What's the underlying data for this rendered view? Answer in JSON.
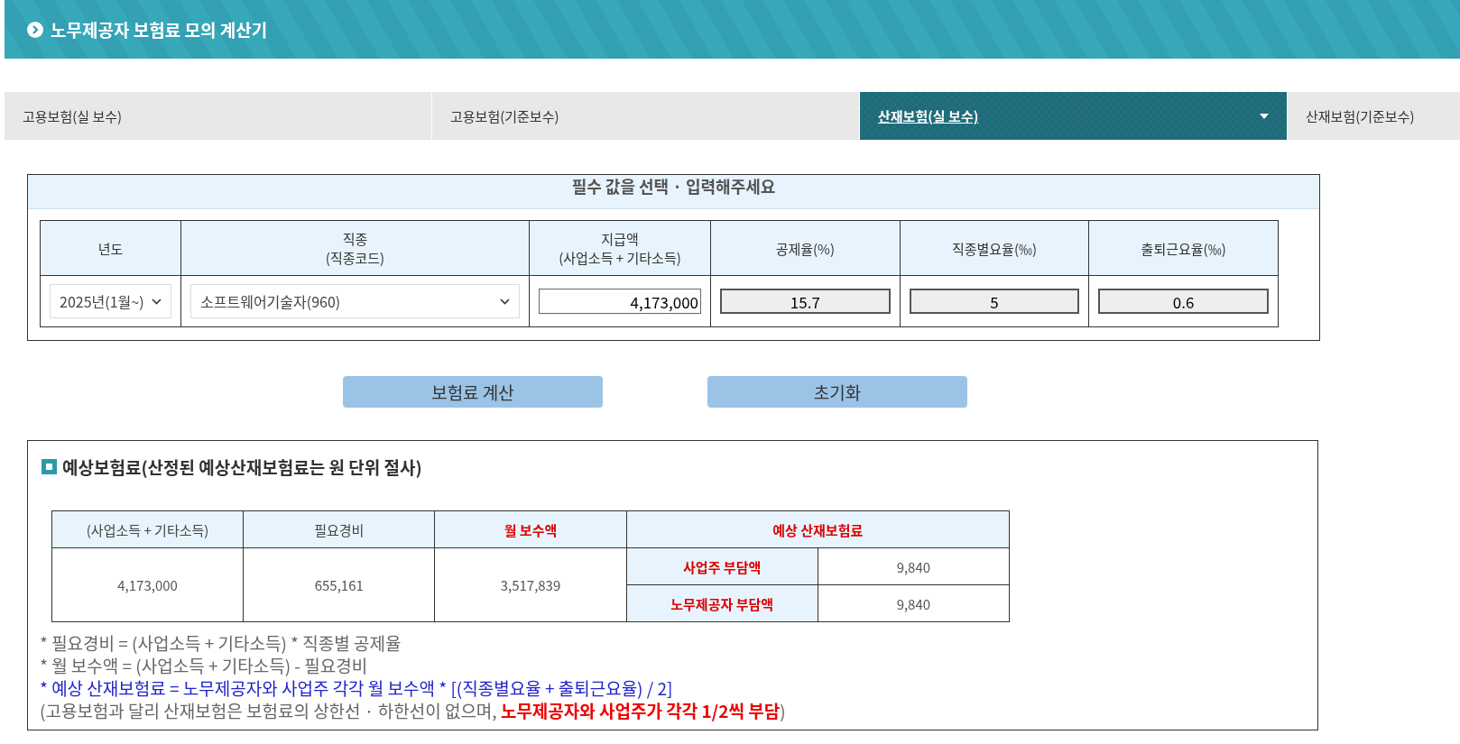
{
  "header": {
    "title": "노무제공자 보험료 모의 계산기"
  },
  "tabs": [
    {
      "label": "고용보험(실 보수)",
      "selected": false
    },
    {
      "label": "고용보험(기준보수)",
      "selected": false
    },
    {
      "label": "산재보험(실 보수)",
      "selected": true
    },
    {
      "label": "산재보험(기준보수)",
      "selected": false
    }
  ],
  "form": {
    "title": "필수 값을 선택 · 입력해주세요",
    "columns": [
      [
        "년도"
      ],
      [
        "직종",
        "(직종코드)"
      ],
      [
        "지급액",
        "(사업소득 + 기타소득)"
      ],
      [
        "공제율(%)"
      ],
      [
        "직종별요율(‰)"
      ],
      [
        "출퇴근요율(‰)"
      ]
    ],
    "fields": [
      {
        "kind": "select",
        "value": "2025년(1월~)"
      },
      {
        "kind": "select",
        "value": "소프트웨어기술자(960)"
      },
      {
        "kind": "input",
        "value": "4,173,000"
      },
      {
        "kind": "readonly",
        "value": "15.7"
      },
      {
        "kind": "readonly",
        "value": "5"
      },
      {
        "kind": "readonly",
        "value": "0.6"
      }
    ]
  },
  "buttons": [
    "보험료 계산",
    "초기화"
  ],
  "result": {
    "title": "예상보험료(산정된 예상산재보험료는 원 단위 절사)",
    "columns": [
      {
        "label": "(사업소득 + 기타소득)",
        "emphasis": false
      },
      {
        "label": "필요경비",
        "emphasis": false
      },
      {
        "label": "월 보수액",
        "emphasis": true
      },
      {
        "label": "예상 산재보험료",
        "emphasis": true
      }
    ],
    "values": [
      "4,173,000",
      "655,161",
      "3,517,839"
    ],
    "shares": [
      {
        "label": "사업주 부담액",
        "value": "9,840"
      },
      {
        "label": "노무제공자 부담액",
        "value": "9,840"
      }
    ],
    "notes": [
      {
        "kind": "plain",
        "text": "* 필요경비 = (사업소득 + 기타소득) * 직종별 공제율"
      },
      {
        "kind": "plain",
        "text": "* 월 보수액 = (사업소득 + 기타소득) - 필요경비"
      },
      {
        "kind": "formula",
        "text": "* 예상 산재보험료 = 노무제공자와 사업주 각각 월 보수액 * [(직종별요율 + 출퇴근요율) / 2]"
      },
      {
        "kind": "plain",
        "text": "(고용보험과 달리 산재보험은 보험료의 상한선 · 하한선이 없으며, **노무제공자와 사업주가 각각 1/2씩 부담**)"
      }
    ]
  }
}
